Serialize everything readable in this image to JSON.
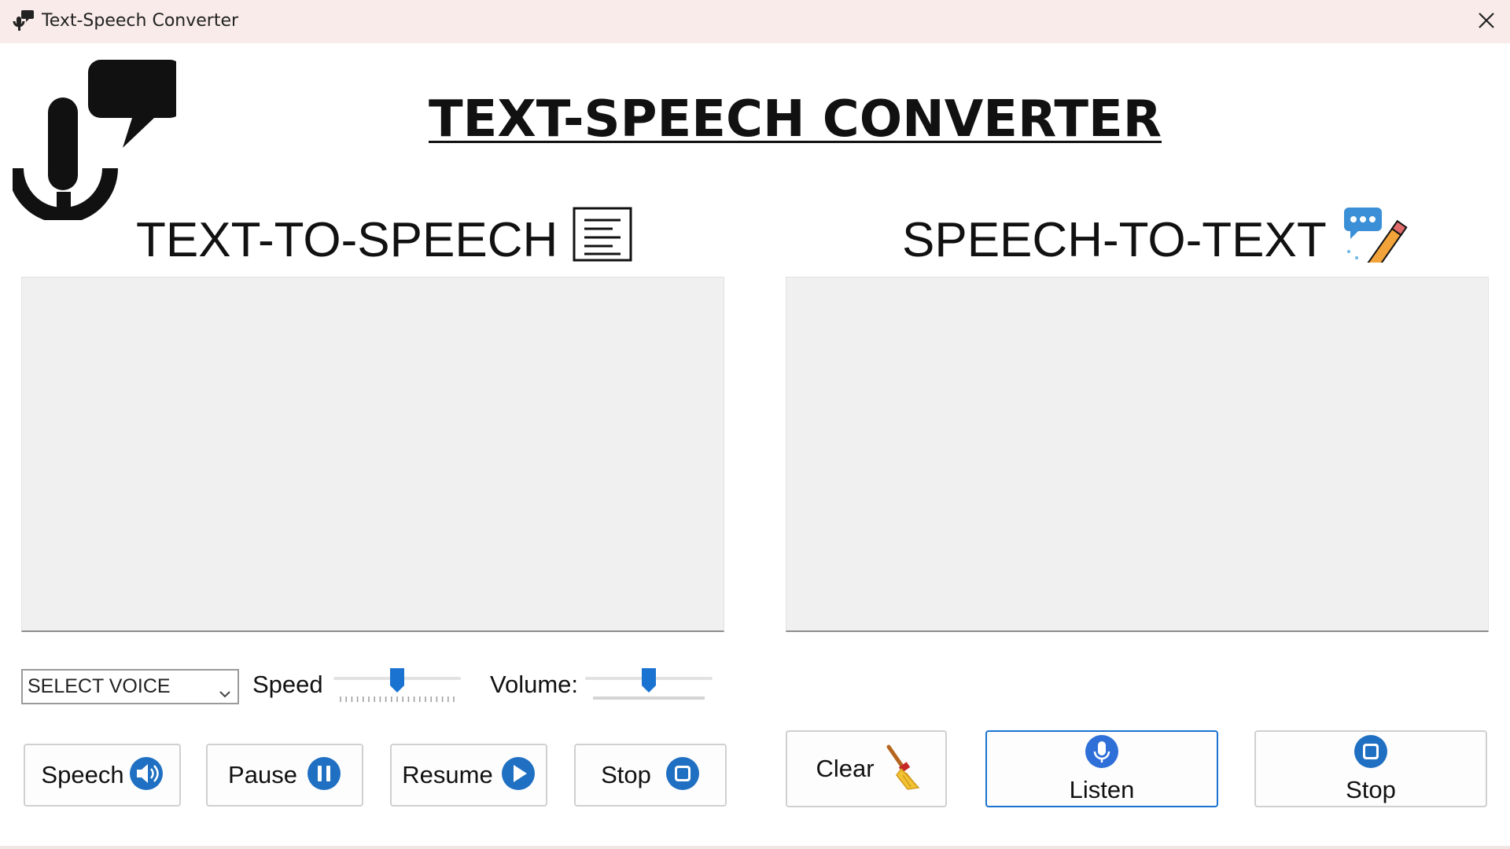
{
  "window": {
    "title": "Text-Speech Converter",
    "close_icon": "close-icon",
    "app_icon": "microphone-speech-icon"
  },
  "header": {
    "logo_icon": "microphone-speech-bubble-logo",
    "title": "TEXT-SPEECH CONVERTER"
  },
  "tts": {
    "title": "TEXT-TO-SPEECH",
    "title_icon": "document-icon",
    "text_value": "",
    "voice_select": {
      "selected": "SELECT VOICE",
      "icon": "chevron-down-icon"
    },
    "speed": {
      "label": "Speed",
      "value_fraction": 0.5
    },
    "volume": {
      "label": "Volume:",
      "value_fraction": 0.5
    },
    "buttons": {
      "speech": {
        "label": "Speech",
        "icon": "speaker-icon"
      },
      "pause": {
        "label": "Pause",
        "icon": "pause-icon"
      },
      "resume": {
        "label": "Resume",
        "icon": "play-icon"
      },
      "stop": {
        "label": "Stop",
        "icon": "stop-icon"
      }
    }
  },
  "stt": {
    "title": "SPEECH-TO-TEXT",
    "title_icon": "chat-pencil-icon",
    "text_value": "",
    "buttons": {
      "clear": {
        "label": "Clear",
        "icon": "broom-icon"
      },
      "listen": {
        "label": "Listen",
        "icon": "microphone-icon"
      },
      "stop": {
        "label": "Stop",
        "icon": "stop-icon"
      }
    }
  },
  "colors": {
    "titlebar": "#f8ebe9",
    "accent_blue": "#1a73d1",
    "textbox_bg": "#f0f0f0"
  }
}
